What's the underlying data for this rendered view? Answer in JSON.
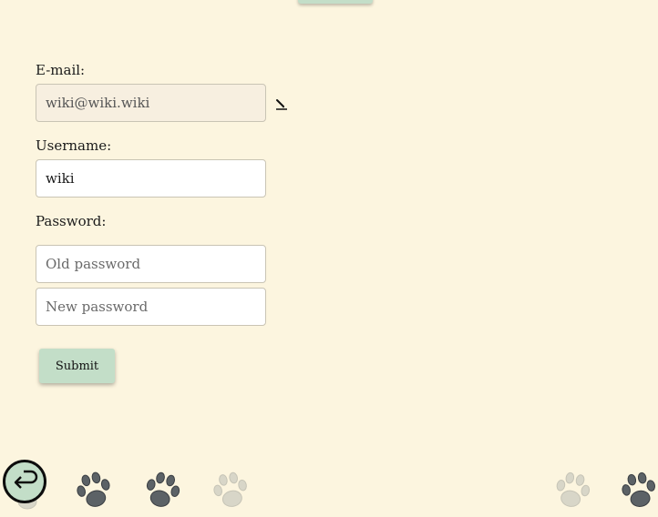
{
  "form": {
    "email_label": "E-mail:",
    "email_value": "wiki@wiki.wiki",
    "username_label": "Username:",
    "username_value": "wiki",
    "password_label": "Password:",
    "old_password_placeholder": "Old password",
    "new_password_placeholder": "New password",
    "submit_label": "Submit"
  },
  "icons": {
    "edit": "pencil-icon",
    "back": "return-arrow-icon",
    "decoration": "paw-print-icon"
  },
  "colors": {
    "background": "#fcf5df",
    "accent": "#c3dec8",
    "paw_dark": "#5c6266",
    "paw_light": "#d8d6c8"
  }
}
